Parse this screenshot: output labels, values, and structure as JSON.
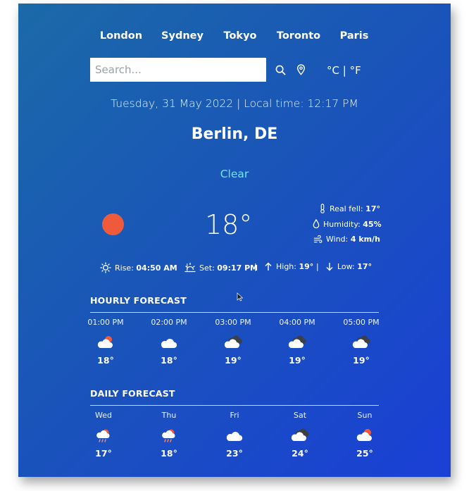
{
  "cities": [
    "London",
    "Sydney",
    "Tokyo",
    "Toronto",
    "Paris"
  ],
  "search": {
    "placeholder": "Search..."
  },
  "icons": {
    "search": "search-icon",
    "location": "location-pin-icon"
  },
  "units_label": "°C | °F",
  "datetime": "Tuesday, 31 May 2022 | Local time: 12:17 PM",
  "location": "Berlin, DE",
  "condition": "Clear",
  "current": {
    "temperature": "18°",
    "real_feel_label": "Real fell:",
    "real_feel_value": "17°",
    "humidity_label": "Humidity:",
    "humidity_value": "45%",
    "wind_label": "Wind:",
    "wind_value": "4 km/h"
  },
  "sun_info": {
    "rise_label": "Rise:",
    "rise_value": "04:50 AM",
    "set_label": "Set:",
    "set_value": "09:17 PM",
    "high_label": "High:",
    "high_value": "19°",
    "low_label": "Low:",
    "low_value": "17°",
    "separator": "|"
  },
  "hourly": {
    "title": "HOURLY FORECAST",
    "items": [
      {
        "label": "01:00 PM",
        "icon": "cloud-sun-icon",
        "temp": "18°"
      },
      {
        "label": "02:00 PM",
        "icon": "cloud-icon",
        "temp": "18°"
      },
      {
        "label": "03:00 PM",
        "icon": "cloud-dark-icon",
        "temp": "19°"
      },
      {
        "label": "04:00 PM",
        "icon": "cloud-dark-icon",
        "temp": "19°"
      },
      {
        "label": "05:00 PM",
        "icon": "cloud-dark-icon",
        "temp": "19°"
      }
    ]
  },
  "daily": {
    "title": "DAILY FORECAST",
    "items": [
      {
        "label": "Wed",
        "icon": "cloud-sun-rain-icon",
        "temp": "17°"
      },
      {
        "label": "Thu",
        "icon": "cloud-sun-rain-icon",
        "temp": "18°"
      },
      {
        "label": "Fri",
        "icon": "cloud-icon",
        "temp": "23°"
      },
      {
        "label": "Sat",
        "icon": "cloud-dark-icon",
        "temp": "24°"
      },
      {
        "label": "Sun",
        "icon": "cloud-sun-icon",
        "temp": "25°"
      }
    ]
  },
  "colors": {
    "card_start": "#1b6aa8",
    "card_end": "#1a3fd6",
    "condition": "#6fe6f2",
    "sun": "#ef5b3a"
  }
}
